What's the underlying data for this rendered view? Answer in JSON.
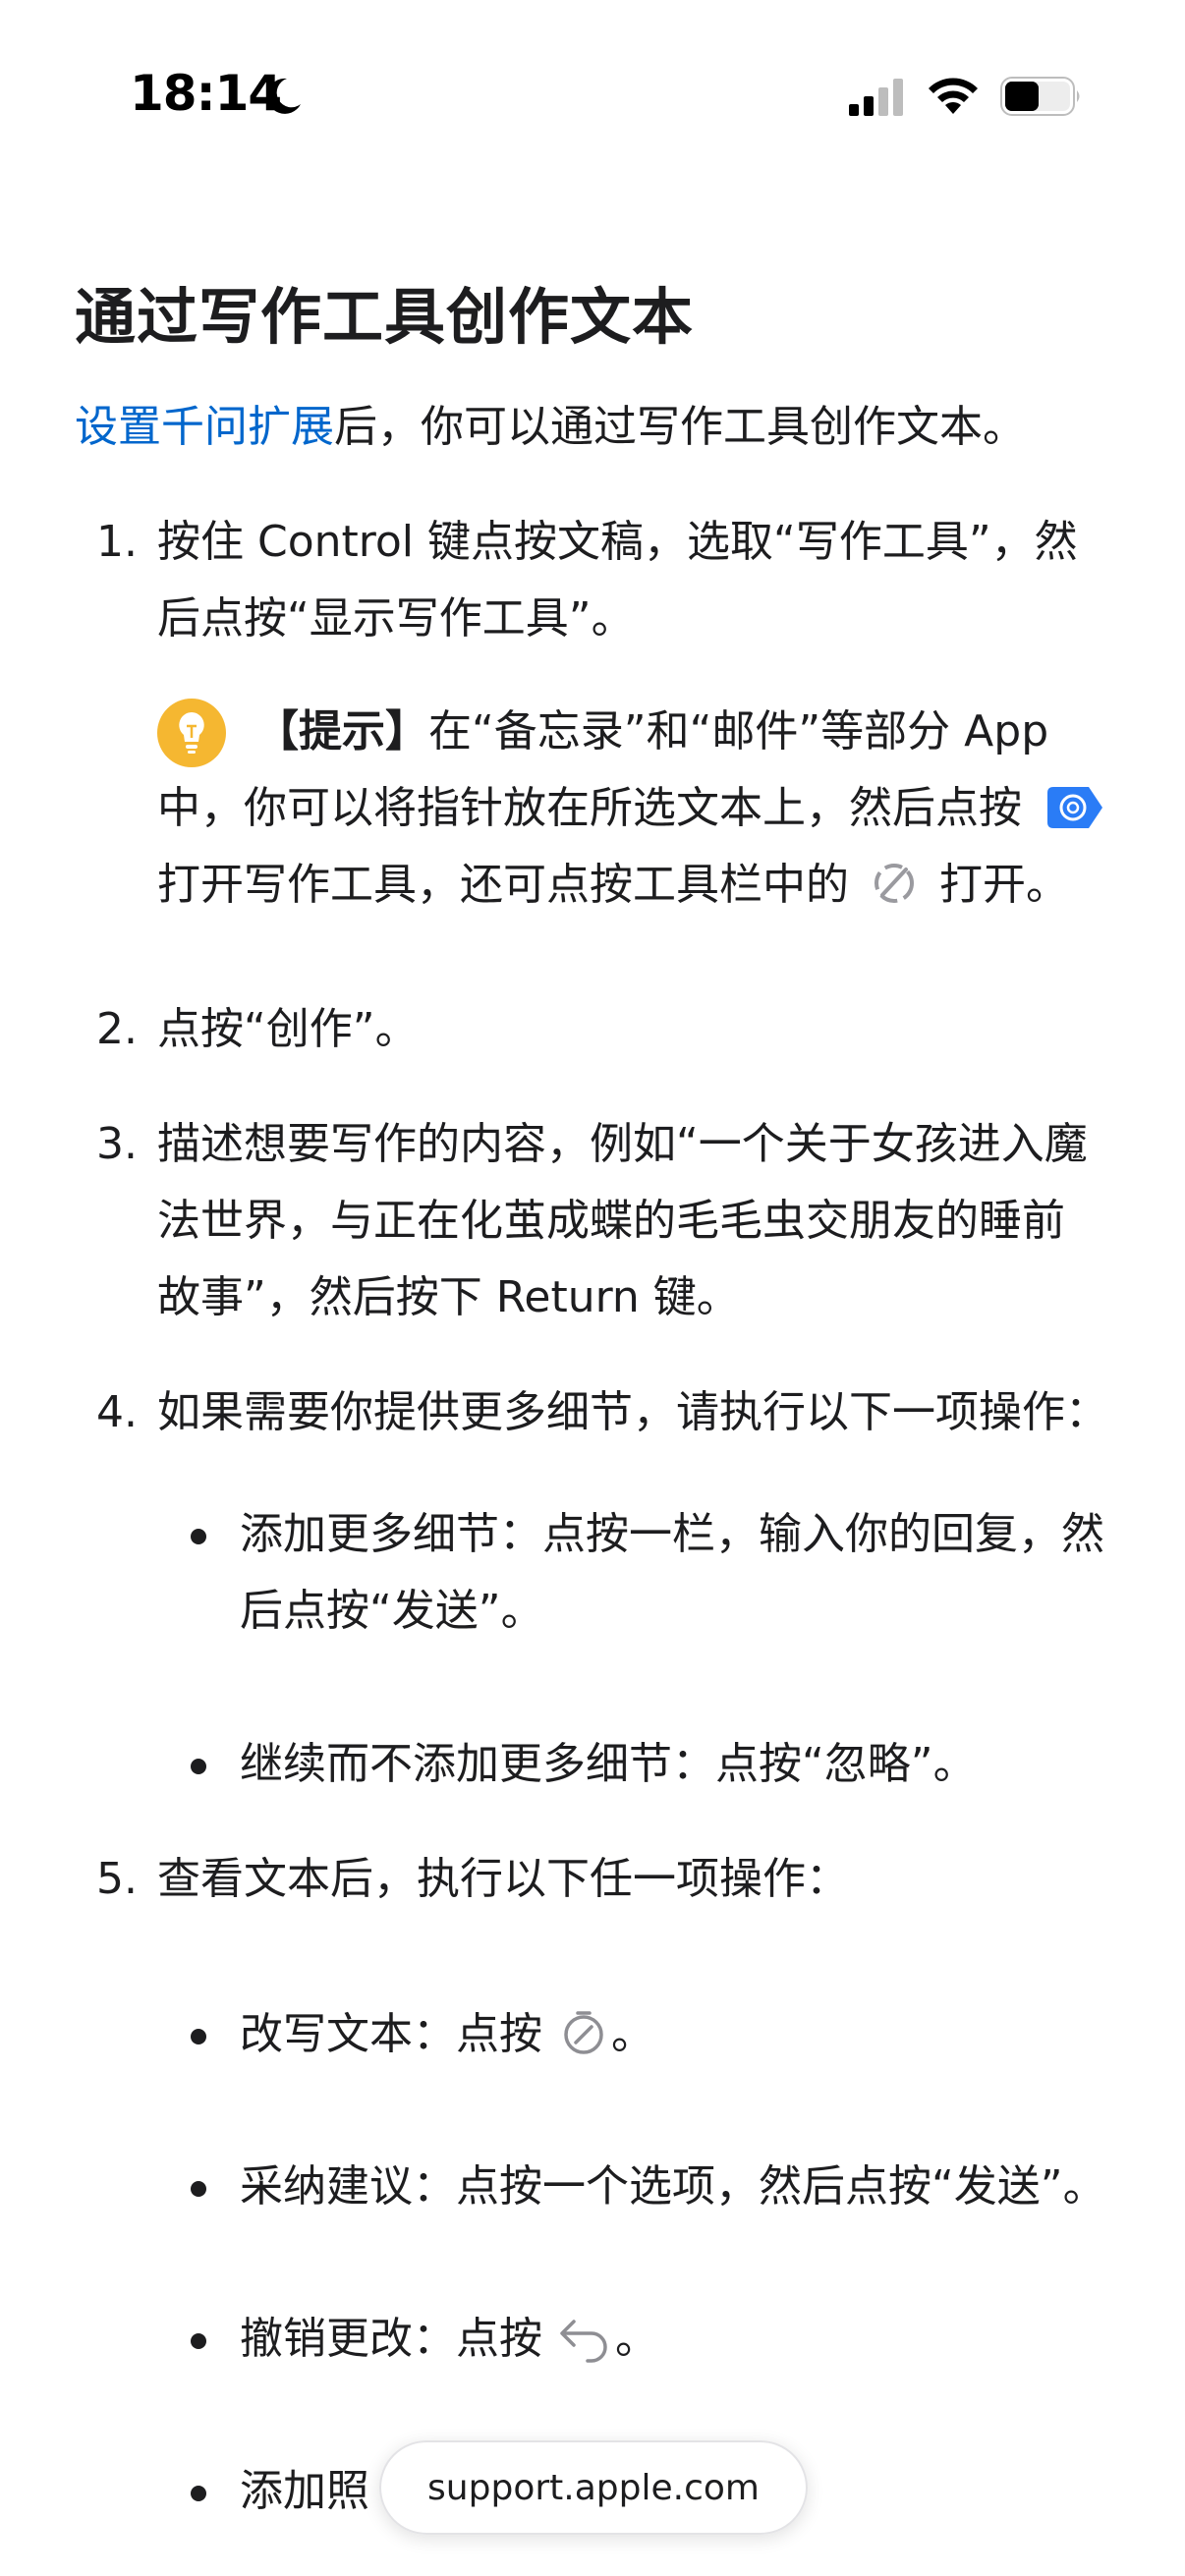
{
  "status_bar": {
    "time": "18:14",
    "icons": [
      "moon-icon",
      "cellular-signal-icon",
      "wifi-icon",
      "battery-icon"
    ]
  },
  "article": {
    "title": "通过写作工具创作文本",
    "intro_link": "设置千问扩展",
    "intro_rest": "后，你可以通过写作工具创作文本。",
    "steps": [
      {
        "number": "1.",
        "line1": "按住 Control 键点按文稿，选取“写作工具”，然",
        "line2": "后点按“显示写作工具”。",
        "tip": {
          "label": "【提示】",
          "line1": "在“备忘录”和“邮件”等部分 App",
          "line2": "中，你可以将指针放在所选文本上，然后点按",
          "line3a": "打开写作工具，还可点按工具栏中的",
          "line3b": "打开。"
        }
      },
      {
        "number": "2.",
        "line1": "点按“创作”。"
      },
      {
        "number": "3.",
        "line1": "描述想要写作的内容，例如“一个关于女孩进入魔",
        "line2": "法世界，与正在化茧成蝶的毛毛虫交朋友的睡前",
        "line3": "故事”，然后按下 Return 键。"
      },
      {
        "number": "4.",
        "line1": "如果需要你提供更多细节，请执行以下一项操作：",
        "bullets": [
          {
            "line1": "添加更多细节：点按一栏，输入你的回复，然",
            "line2": "后点按“发送”。"
          },
          {
            "line1": "继续而不添加更多细节：点按“忽略”。"
          }
        ]
      },
      {
        "number": "5.",
        "line1": "查看文本后，执行以下任一项操作：",
        "bullets": [
          {
            "text_a": "改写文本：点按",
            "text_b": "。"
          },
          {
            "line1": "采纳建议：点按一个选项，然后点按“发送”。"
          },
          {
            "text_a": "撤销更改：点按",
            "text_b": "。"
          },
          {
            "text_a": "添加照"
          }
        ]
      }
    ]
  },
  "url_bar": {
    "domain": "support.apple.com"
  },
  "colors": {
    "link": "#0066cc",
    "text": "#1d1d1f",
    "tip_bulb": "#f5b731",
    "apple_intelligence": "#2a7cf6"
  }
}
